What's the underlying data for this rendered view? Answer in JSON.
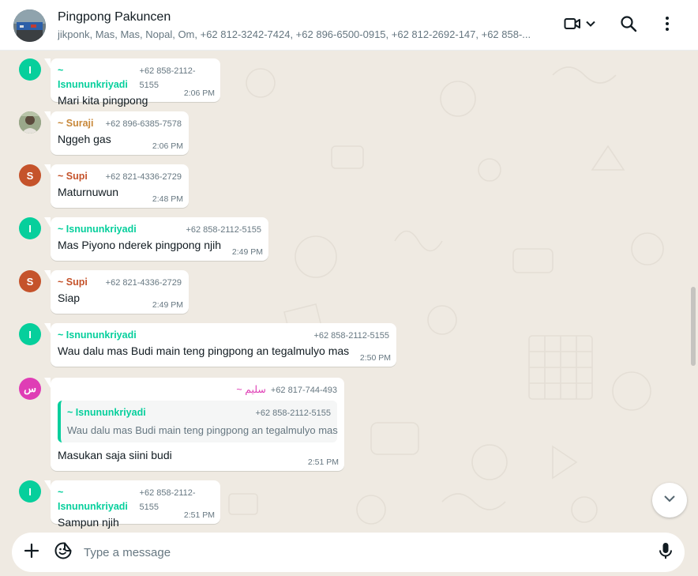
{
  "header": {
    "title": "Pingpong Pakuncen",
    "members": "jikponk, Mas, Mas, Nopal, Om, +62 812-3242-7424, +62 896-6500-0915, +62 812-2692-147, +62 858-..."
  },
  "icons": {
    "video": "video-camera-icon",
    "chevron": "chevron-down-icon",
    "search": "search-icon",
    "menu": "more-vertical-icon",
    "plus": "plus-icon",
    "sticker": "sticker-icon",
    "mic": "microphone-icon",
    "scroll": "chevron-down-icon"
  },
  "colors": {
    "green_sender": "#06cf9c",
    "orange_sender": "#c8883a",
    "red_sender": "#c5532b",
    "pink_sender": "#df3db5",
    "chat_bg": "#efeae2"
  },
  "messages": [
    {
      "avatar": "I",
      "avatar_color": "#06cf9c",
      "sender": "~ Isnununkriyadi",
      "sender_color": "#06cf9c",
      "phone": "+62 858-2112-5155",
      "text": "Mari kita pingpong",
      "time": "2:06 PM"
    },
    {
      "avatar": "",
      "avatar_color": "#7a8f6a",
      "sender": "~ Suraji",
      "sender_color": "#c8883a",
      "phone": "+62 896-6385-7578",
      "text": "Nggeh gas",
      "time": "2:06 PM"
    },
    {
      "avatar": "S",
      "avatar_color": "#c5532b",
      "sender": "~ Supi",
      "sender_color": "#c5532b",
      "phone": "+62 821-4336-2729",
      "text": "Maturnuwun",
      "time": "2:48 PM"
    },
    {
      "avatar": "I",
      "avatar_color": "#06cf9c",
      "sender": "~ Isnununkriyadi",
      "sender_color": "#06cf9c",
      "phone": "+62 858-2112-5155",
      "text": "Mas Piyono nderek pingpong njih",
      "time": "2:49 PM"
    },
    {
      "avatar": "S",
      "avatar_color": "#c5532b",
      "sender": "~ Supi",
      "sender_color": "#c5532b",
      "phone": "+62 821-4336-2729",
      "text": "Siap",
      "time": "2:49 PM"
    },
    {
      "avatar": "I",
      "avatar_color": "#06cf9c",
      "sender": "~ Isnununkriyadi",
      "sender_color": "#06cf9c",
      "phone": "+62 858-2112-5155",
      "text": "Wau dalu mas Budi main teng pingpong an tegalmulyo mas",
      "time": "2:50 PM"
    },
    {
      "avatar": "س",
      "avatar_color": "#df3db5",
      "sender": "~ سليم",
      "sender_color": "#df3db5",
      "phone": "+62 817-744-493",
      "text": "Masukan saja siini budi",
      "time": "2:51 PM",
      "quote": {
        "sender": "~ Isnununkriyadi",
        "phone": "+62 858-2112-5155",
        "text": "Wau dalu mas Budi main teng pingpong an tegalmulyo mas"
      }
    },
    {
      "avatar": "I",
      "avatar_color": "#06cf9c",
      "sender": "~ Isnununkriyadi",
      "sender_color": "#06cf9c",
      "phone": "+62 858-2112-5155",
      "text": "Sampun njih",
      "time": "2:51 PM"
    }
  ],
  "composer": {
    "placeholder": "Type a message"
  }
}
